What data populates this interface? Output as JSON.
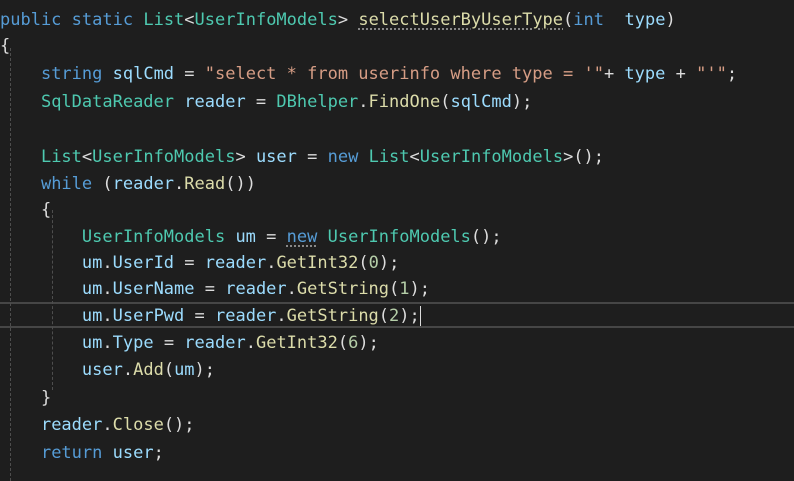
{
  "colors": {
    "background": "#1e1e1e",
    "keyword": "#569cd6",
    "type": "#4ec9b0",
    "method": "#dcdcaa",
    "identifier": "#9cdcfe",
    "string": "#d69d85",
    "number": "#b5cea8",
    "plain": "#dcdcdc"
  },
  "code_lines": [
    {
      "tokens": [
        {
          "t": "public",
          "c": "kw"
        },
        {
          "t": " ",
          "c": "pl"
        },
        {
          "t": "static",
          "c": "kw"
        },
        {
          "t": " ",
          "c": "pl"
        },
        {
          "t": "List",
          "c": "type"
        },
        {
          "t": "<",
          "c": "pl"
        },
        {
          "t": "UserInfoModels",
          "c": "type"
        },
        {
          "t": "> ",
          "c": "pl"
        },
        {
          "t": "selectUserByUserType",
          "c": "fn",
          "squiggle": true
        },
        {
          "t": "(",
          "c": "pl"
        },
        {
          "t": "int",
          "c": "kw"
        },
        {
          "t": "  ",
          "c": "pl"
        },
        {
          "t": "type",
          "c": "id"
        },
        {
          "t": ")",
          "c": "pl"
        }
      ]
    },
    {
      "tokens": [
        {
          "t": "{",
          "c": "pl"
        }
      ]
    },
    {
      "tokens": [
        {
          "t": "    ",
          "c": "pl"
        },
        {
          "t": "string",
          "c": "kw"
        },
        {
          "t": " ",
          "c": "pl"
        },
        {
          "t": "sqlCmd",
          "c": "id"
        },
        {
          "t": " = ",
          "c": "pl"
        },
        {
          "t": "\"select * from userinfo where type = '\"",
          "c": "str"
        },
        {
          "t": "+ ",
          "c": "pl"
        },
        {
          "t": "type",
          "c": "id"
        },
        {
          "t": " + ",
          "c": "pl"
        },
        {
          "t": "\"'\"",
          "c": "str"
        },
        {
          "t": ";",
          "c": "pl"
        }
      ]
    },
    {
      "tokens": [
        {
          "t": "    ",
          "c": "pl"
        },
        {
          "t": "SqlDataReader",
          "c": "type"
        },
        {
          "t": " ",
          "c": "pl"
        },
        {
          "t": "reader",
          "c": "id"
        },
        {
          "t": " = ",
          "c": "pl"
        },
        {
          "t": "DBhelper",
          "c": "type"
        },
        {
          "t": ".",
          "c": "pl"
        },
        {
          "t": "FindOne",
          "c": "fn"
        },
        {
          "t": "(",
          "c": "pl"
        },
        {
          "t": "sqlCmd",
          "c": "id"
        },
        {
          "t": ");",
          "c": "pl"
        }
      ]
    },
    {
      "tokens": []
    },
    {
      "tokens": [
        {
          "t": "    ",
          "c": "pl"
        },
        {
          "t": "List",
          "c": "type"
        },
        {
          "t": "<",
          "c": "pl"
        },
        {
          "t": "UserInfoModels",
          "c": "type"
        },
        {
          "t": "> ",
          "c": "pl"
        },
        {
          "t": "user",
          "c": "id"
        },
        {
          "t": " = ",
          "c": "pl"
        },
        {
          "t": "new",
          "c": "kw"
        },
        {
          "t": " ",
          "c": "pl"
        },
        {
          "t": "List",
          "c": "type"
        },
        {
          "t": "<",
          "c": "pl"
        },
        {
          "t": "UserInfoModels",
          "c": "type"
        },
        {
          "t": ">();",
          "c": "pl"
        }
      ]
    },
    {
      "tokens": [
        {
          "t": "    ",
          "c": "pl"
        },
        {
          "t": "while",
          "c": "kw"
        },
        {
          "t": " (",
          "c": "pl"
        },
        {
          "t": "reader",
          "c": "id"
        },
        {
          "t": ".",
          "c": "pl"
        },
        {
          "t": "Read",
          "c": "fn"
        },
        {
          "t": "())",
          "c": "pl"
        }
      ]
    },
    {
      "tokens": [
        {
          "t": "    ",
          "c": "pl"
        },
        {
          "t": "{",
          "c": "pl"
        }
      ]
    },
    {
      "tokens": [
        {
          "t": "        ",
          "c": "pl"
        },
        {
          "t": "UserInfoModels",
          "c": "type"
        },
        {
          "t": " ",
          "c": "pl"
        },
        {
          "t": "um",
          "c": "id"
        },
        {
          "t": " = ",
          "c": "pl"
        },
        {
          "t": "new",
          "c": "kw",
          "squiggle": true
        },
        {
          "t": " ",
          "c": "pl"
        },
        {
          "t": "UserInfoModels",
          "c": "type"
        },
        {
          "t": "();",
          "c": "pl"
        }
      ]
    },
    {
      "tokens": [
        {
          "t": "        ",
          "c": "pl"
        },
        {
          "t": "um",
          "c": "id"
        },
        {
          "t": ".",
          "c": "pl"
        },
        {
          "t": "UserId",
          "c": "id"
        },
        {
          "t": " = ",
          "c": "pl"
        },
        {
          "t": "reader",
          "c": "id"
        },
        {
          "t": ".",
          "c": "pl"
        },
        {
          "t": "GetInt32",
          "c": "fn"
        },
        {
          "t": "(",
          "c": "pl"
        },
        {
          "t": "0",
          "c": "num"
        },
        {
          "t": ");",
          "c": "pl"
        }
      ]
    },
    {
      "tokens": [
        {
          "t": "        ",
          "c": "pl"
        },
        {
          "t": "um",
          "c": "id"
        },
        {
          "t": ".",
          "c": "pl"
        },
        {
          "t": "UserName",
          "c": "id"
        },
        {
          "t": " = ",
          "c": "pl"
        },
        {
          "t": "reader",
          "c": "id"
        },
        {
          "t": ".",
          "c": "pl"
        },
        {
          "t": "GetString",
          "c": "fn"
        },
        {
          "t": "(",
          "c": "pl"
        },
        {
          "t": "1",
          "c": "num"
        },
        {
          "t": ");",
          "c": "pl"
        }
      ]
    },
    {
      "tokens": [
        {
          "t": "        ",
          "c": "pl"
        },
        {
          "t": "um",
          "c": "id"
        },
        {
          "t": ".",
          "c": "pl"
        },
        {
          "t": "UserPwd",
          "c": "id"
        },
        {
          "t": " = ",
          "c": "pl"
        },
        {
          "t": "reader",
          "c": "id"
        },
        {
          "t": ".",
          "c": "pl"
        },
        {
          "t": "GetString",
          "c": "fn"
        },
        {
          "t": "(",
          "c": "pl"
        },
        {
          "t": "2",
          "c": "num"
        },
        {
          "t": ");",
          "c": "pl"
        }
      ],
      "caret": true
    },
    {
      "tokens": [
        {
          "t": "        ",
          "c": "pl"
        },
        {
          "t": "um",
          "c": "id"
        },
        {
          "t": ".",
          "c": "pl"
        },
        {
          "t": "Type",
          "c": "id"
        },
        {
          "t": " = ",
          "c": "pl"
        },
        {
          "t": "reader",
          "c": "id"
        },
        {
          "t": ".",
          "c": "pl"
        },
        {
          "t": "GetInt32",
          "c": "fn"
        },
        {
          "t": "(",
          "c": "pl"
        },
        {
          "t": "6",
          "c": "num"
        },
        {
          "t": ");",
          "c": "pl"
        }
      ]
    },
    {
      "tokens": [
        {
          "t": "        ",
          "c": "pl"
        },
        {
          "t": "user",
          "c": "id"
        },
        {
          "t": ".",
          "c": "pl"
        },
        {
          "t": "Add",
          "c": "fn"
        },
        {
          "t": "(",
          "c": "pl"
        },
        {
          "t": "um",
          "c": "id"
        },
        {
          "t": ");",
          "c": "pl"
        }
      ]
    },
    {
      "tokens": [
        {
          "t": "    ",
          "c": "pl"
        },
        {
          "t": "}",
          "c": "pl"
        }
      ]
    },
    {
      "tokens": [
        {
          "t": "    ",
          "c": "pl"
        },
        {
          "t": "reader",
          "c": "id"
        },
        {
          "t": ".",
          "c": "pl"
        },
        {
          "t": "Close",
          "c": "fn"
        },
        {
          "t": "();",
          "c": "pl"
        }
      ]
    },
    {
      "tokens": [
        {
          "t": "    ",
          "c": "pl"
        },
        {
          "t": "return",
          "c": "kw"
        },
        {
          "t": " ",
          "c": "pl"
        },
        {
          "t": "user",
          "c": "id"
        },
        {
          "t": ";",
          "c": "pl"
        }
      ]
    }
  ]
}
